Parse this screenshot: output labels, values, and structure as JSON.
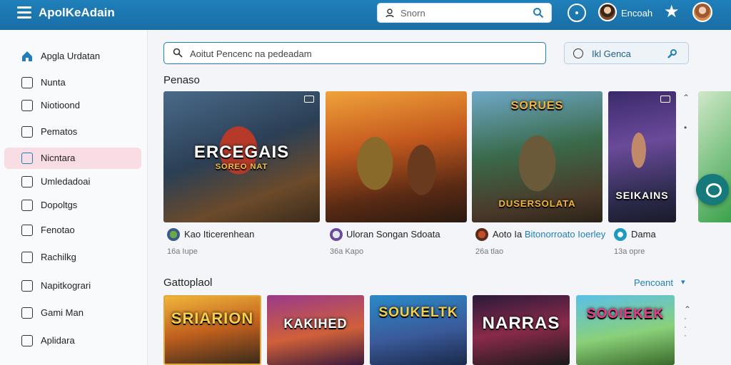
{
  "topbar": {
    "app_title": "ApolKeAdain",
    "search_placeholder": "Snorn",
    "user_name": "Encoah",
    "icons": [
      "menu-icon",
      "search-icon",
      "compass-icon",
      "star-icon",
      "avatar"
    ]
  },
  "sidebar": {
    "items": [
      {
        "label": "Apgla Urdatan",
        "icon": "home-icon"
      },
      {
        "label": "Nunta",
        "icon": "info-icon"
      },
      {
        "label": "Niotioond",
        "icon": "calendar-icon"
      },
      {
        "label": "Pematos",
        "icon": "edit-icon"
      },
      {
        "label": "Nicntara",
        "icon": "save-icon",
        "active": true
      },
      {
        "label": "Umledadoai",
        "icon": "close-box-icon"
      },
      {
        "label": "Dopoltgs",
        "icon": "clipboard-icon"
      },
      {
        "label": "Fenotao",
        "icon": "flag-icon"
      },
      {
        "label": "Rachilkg",
        "icon": "square-icon"
      },
      {
        "label": "Napitkograri",
        "icon": "tag-icon"
      },
      {
        "label": "Gami Man",
        "icon": "check-box-icon"
      },
      {
        "label": "Aplidara",
        "icon": "pencil-icon"
      }
    ]
  },
  "main": {
    "search_placeholder": "Aoitut Pencenc na pedeadam",
    "genre_label": "Ikl Genca",
    "section1_title": "Penaso",
    "section2_title": "Gattoplaol",
    "sort_label": "Pencoant",
    "row1": [
      {
        "art_text": "ERCEGAIS",
        "art_sub": "SOREO NAT",
        "title": "Kao Iticerenhean",
        "sub": "16a Iupe"
      },
      {
        "art_text": "",
        "art_sub": "",
        "title": "Uloran Songan Sdoata",
        "sub": "36a Kapo"
      },
      {
        "art_text": "SORUES",
        "art_sub": "DUSERSOLATA",
        "title": "Aoto Ia",
        "title_hl": "Bitonorroato Ioerley",
        "sub": "26a tlao"
      },
      {
        "art_text": "SEIKAINS",
        "art_sub": "",
        "title": "Dama",
        "sub": "13a opre"
      }
    ],
    "row2": [
      {
        "art_text": "SRIARION"
      },
      {
        "art_text": "KAKIHED"
      },
      {
        "art_text": "SOUKELTK"
      },
      {
        "art_text": "NARRAS"
      },
      {
        "art_text": "SOOIEKEK"
      }
    ]
  },
  "colors": {
    "topbar": "#1f7fb9",
    "accent": "#1f7fb9",
    "active_item_bg": "#f9dde4",
    "fab": "#167a7a"
  }
}
